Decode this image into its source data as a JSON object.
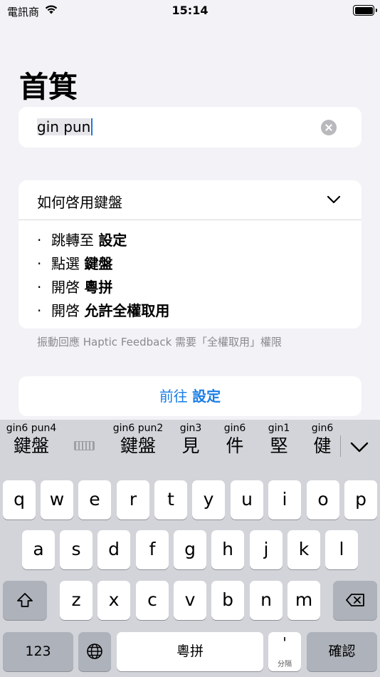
{
  "status_bar": {
    "carrier": "電訊商",
    "time": "15:14"
  },
  "page": {
    "title": "首箕"
  },
  "search": {
    "value_selected": "gin pun",
    "clear_icon": "clear-circle-icon"
  },
  "help": {
    "title": "如何啓用鍵盤",
    "steps": [
      {
        "prefix": "跳轉至 ",
        "emph": "設定"
      },
      {
        "prefix": "點選 ",
        "emph": "鍵盤"
      },
      {
        "prefix": "開啓 ",
        "emph": "粵拼"
      },
      {
        "prefix": "開啓 ",
        "emph": "允許全權取用"
      }
    ],
    "note": "振動回應 Haptic Feedback 需要「全權取用」權限"
  },
  "goto_button": {
    "prefix": "前往 ",
    "emph": "設定"
  },
  "keyboard": {
    "candidates": [
      {
        "romanization": "gin6 pun4",
        "char": "鍵盤"
      },
      {
        "romanization": "gin6 pun2",
        "char": "鍵盤"
      },
      {
        "romanization": "gin3",
        "char": "見"
      },
      {
        "romanization": "gin6",
        "char": "件"
      },
      {
        "romanization": "gin1",
        "char": "堅"
      },
      {
        "romanization": "gin6",
        "char": "健"
      }
    ],
    "row1": [
      "q",
      "w",
      "e",
      "r",
      "t",
      "y",
      "u",
      "i",
      "o",
      "p"
    ],
    "row2": [
      "a",
      "s",
      "d",
      "f",
      "g",
      "h",
      "j",
      "k",
      "l"
    ],
    "row3": [
      "z",
      "x",
      "c",
      "v",
      "b",
      "n",
      "m"
    ],
    "numbers_key": "123",
    "space_label": "粵拼",
    "apostrophe_key": "'",
    "apostrophe_sub": "分隔",
    "confirm_key": "確認"
  }
}
